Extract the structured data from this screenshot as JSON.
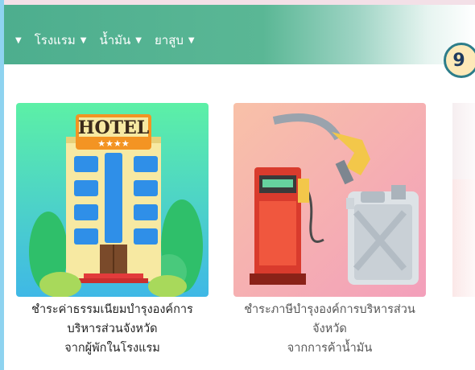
{
  "nav": {
    "items": [
      {
        "label": ""
      },
      {
        "label": "โรงแรม"
      },
      {
        "label": "น้ำมัน"
      },
      {
        "label": "ยาสูบ"
      }
    ]
  },
  "step_badge": "9",
  "cards": [
    {
      "sign_text": "HOTEL",
      "stars": "★★★★",
      "caption": [
        "ชำระค่าธรรมเนียมบำรุงองค์การ",
        "บริหารส่วนจังหวัด",
        "จากผู้พักในโรงแรม"
      ]
    },
    {
      "caption": [
        "ชำระภาษีบำรุงองค์การบริหารส่วน",
        "จังหวัด",
        "จากการค้าน้ำมัน"
      ]
    }
  ],
  "colors": {
    "nav_green": "#4dae8e",
    "badge_fill": "#fde9b8",
    "badge_border": "#2d7d8a",
    "hotel_bg_top": "#5cf0a6",
    "hotel_bg_bottom": "#3fb8e6",
    "fuel_bg_top": "#f8b7a2",
    "fuel_bg_bottom": "#f3a1b8"
  },
  "icons": {
    "hotel_card": "hotel-building-icon",
    "fuel_card": "fuel-pump-and-jerrycan-icon"
  }
}
